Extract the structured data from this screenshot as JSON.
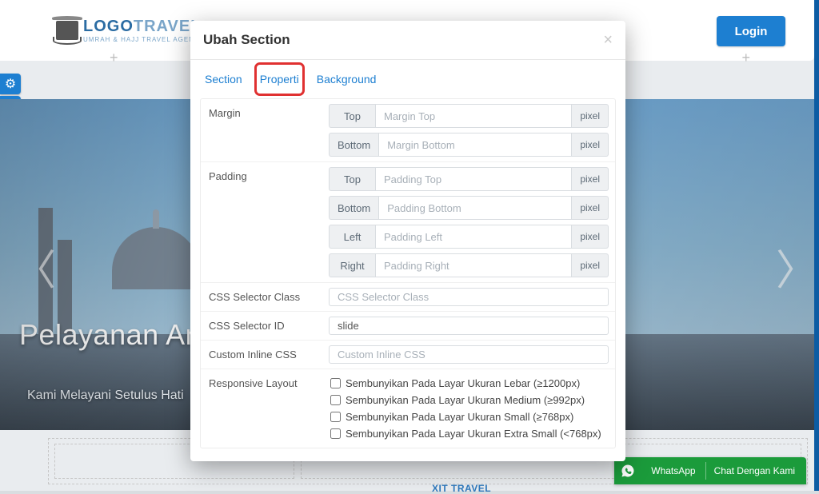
{
  "logo": {
    "main1": "LOGO",
    "main2": "TRAVEL",
    "sub": "UMRAH & HAJJ TRAVEL AGENT"
  },
  "login_label": "Login",
  "hero": {
    "title": "Pelayanan An",
    "subtitle": "Kami Melayani Setulus Hati"
  },
  "whatsapp": {
    "label": "WhatsApp",
    "text": "Chat Dengan Kami"
  },
  "brand_mini": "XIT TRAVEL",
  "modal": {
    "title": "Ubah Section",
    "tabs": {
      "section": "Section",
      "properti": "Properti",
      "background": "Background"
    },
    "labels": {
      "margin": "Margin",
      "padding": "Padding",
      "css_class": "CSS Selector Class",
      "css_id": "CSS Selector ID",
      "custom_css": "Custom Inline CSS",
      "responsive": "Responsive Layout"
    },
    "addons": {
      "top": "Top",
      "bottom": "Bottom",
      "left": "Left",
      "right": "Right",
      "pixel": "pixel"
    },
    "placeholders": {
      "margin_top": "Margin Top",
      "margin_bottom": "Margin Bottom",
      "padding_top": "Padding Top",
      "padding_bottom": "Padding Bottom",
      "padding_left": "Padding Left",
      "padding_right": "Padding Right",
      "css_class": "CSS Selector Class",
      "custom_css": "Custom Inline CSS"
    },
    "values": {
      "css_id": "slide"
    },
    "responsive_opts": {
      "lg": "Sembunyikan Pada Layar Ukuran Lebar (≥1200px)",
      "md": "Sembunyikan Pada Layar Ukuran Medium (≥992px)",
      "sm": "Sembunyikan Pada Layar Ukuran Small (≥768px)",
      "xs": "Sembunyikan Pada Layar Ukuran Extra Small (<768px)"
    }
  }
}
